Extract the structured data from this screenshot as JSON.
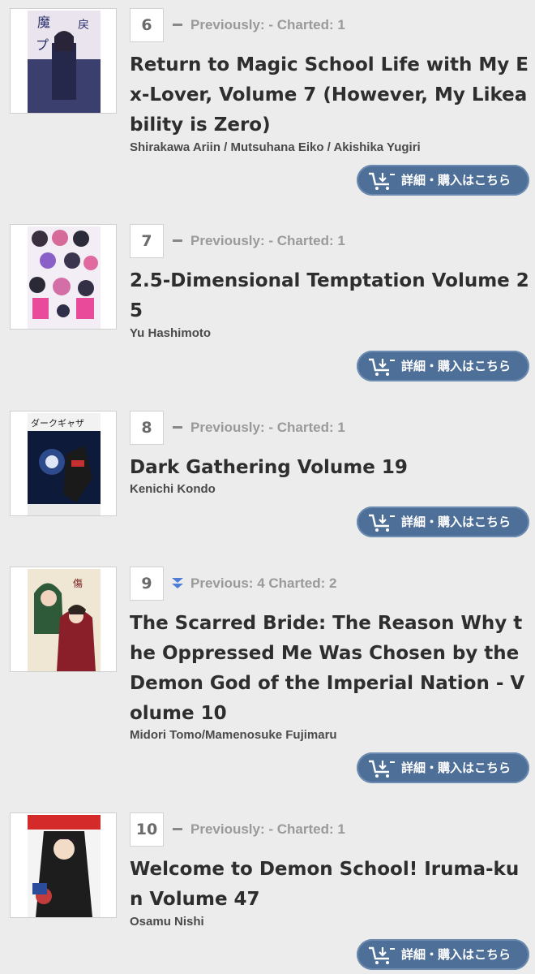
{
  "entries": [
    {
      "rank": "6",
      "trend": "flat",
      "previous": "Previously: - Charted: 1",
      "title": "Return to Magic School Life with My Ex-Lover, Volume 7 (However, My Likeability is Zero)",
      "author": "Shirakawa Ariin / Mutsuhana Eiko / Akishika Yugiri",
      "button": "詳細・購入はこちら"
    },
    {
      "rank": "7",
      "trend": "flat",
      "previous": "Previously: - Charted: 1",
      "title": "2.5-Dimensional Temptation Volume 25",
      "author": "Yu Hashimoto",
      "button": "詳細・購入はこちら"
    },
    {
      "rank": "8",
      "trend": "flat",
      "previous": "Previously: - Charted: 1",
      "title": "Dark Gathering Volume 19",
      "author": "Kenichi Kondo",
      "button": "詳細・購入はこちら"
    },
    {
      "rank": "9",
      "trend": "down",
      "previous": "Previous: 4 Charted: 2",
      "title": "The Scarred Bride: The Reason Why the Oppressed Me Was Chosen by the Demon God of the Imperial Nation - Volume 10",
      "author": "Midori Tomo/Mamenosuke Fujimaru",
      "button": "詳細・購入はこちら"
    },
    {
      "rank": "10",
      "trend": "flat",
      "previous": "Previously: - Charted: 1",
      "title": "Welcome to Demon School! Iruma-kun Volume 47",
      "author": "Osamu Nishi",
      "button": "詳細・購入はこちら"
    }
  ]
}
